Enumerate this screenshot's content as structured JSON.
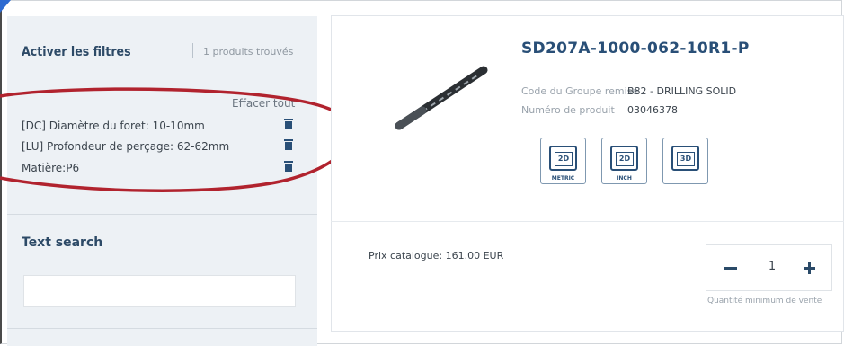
{
  "filters": {
    "title": "Activer les filtres",
    "count_text": "1 produits trouvés",
    "clear_all_label": "Effacer tout",
    "items": [
      {
        "label": "[DC] Diamètre du foret: 10-10mm"
      },
      {
        "label": "[LU] Profondeur de perçage: 62-62mm"
      },
      {
        "label": "Matière:P6"
      }
    ]
  },
  "text_search": {
    "title": "Text search",
    "value": "",
    "placeholder": ""
  },
  "product": {
    "title": "SD207A-1000-062-10R1-P",
    "discount_group_label": "Code du Groupe remise",
    "discount_group_value": "B82 - DRILLING SOLID",
    "product_number_label": "Numéro de produit",
    "product_number_value": "03046378",
    "cad_buttons": [
      {
        "code": "2D",
        "sub": "METRIC"
      },
      {
        "code": "2D",
        "sub": "INCH"
      },
      {
        "code": "3D",
        "sub": ""
      }
    ],
    "price_text": "Prix catalogue: 161.00 EUR",
    "quantity": "1",
    "min_sale_text": "Quantité minimum de vente"
  },
  "colors": {
    "accent": "#294f77",
    "panel_bg": "#edf1f5",
    "annotation": "#b1232e"
  },
  "icons": {
    "delete": "trash-icon",
    "product": "drill-bit-image"
  }
}
